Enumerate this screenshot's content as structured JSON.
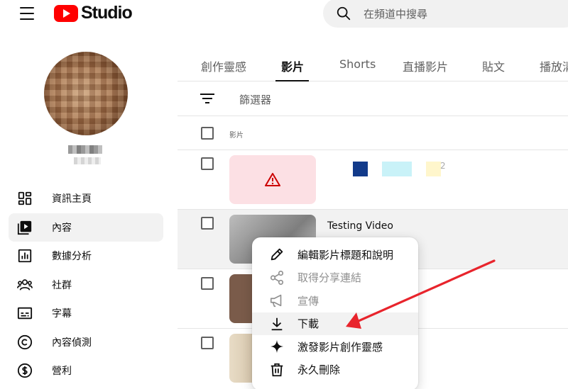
{
  "header": {
    "logo_text": "Studio",
    "search_placeholder": "在頻道中搜尋"
  },
  "sidebar": {
    "items": [
      {
        "label": "資訊主頁",
        "icon": "dashboard-icon",
        "active": false
      },
      {
        "label": "內容",
        "icon": "content-icon",
        "active": true
      },
      {
        "label": "數據分析",
        "icon": "analytics-icon",
        "active": false
      },
      {
        "label": "社群",
        "icon": "community-icon",
        "active": false
      },
      {
        "label": "字幕",
        "icon": "subtitles-icon",
        "active": false
      },
      {
        "label": "內容偵測",
        "icon": "copyright-icon",
        "active": false
      },
      {
        "label": "營利",
        "icon": "monetization-icon",
        "active": false
      }
    ]
  },
  "tabs": [
    {
      "label": "創作靈感",
      "active": false
    },
    {
      "label": "影片",
      "active": true
    },
    {
      "label": "Shorts",
      "active": false
    },
    {
      "label": "直播影片",
      "active": false
    },
    {
      "label": "貼文",
      "active": false
    },
    {
      "label": "播放清",
      "active": false
    }
  ],
  "filter": {
    "label": "篩選器"
  },
  "table": {
    "column_header": "影片",
    "rows": [
      {
        "title": "",
        "number": "2",
        "thumbnail": "error"
      },
      {
        "title": "Testing Video",
        "thumbnail": "video"
      },
      {
        "title": "",
        "thumbnail": "video"
      },
      {
        "title": "",
        "thumbnail": "video"
      }
    ]
  },
  "menu": {
    "items": [
      {
        "label": "編輯影片標題和說明",
        "icon": "pencil-icon",
        "disabled": false
      },
      {
        "label": "取得分享連結",
        "icon": "share-icon",
        "disabled": true
      },
      {
        "label": "宣傳",
        "icon": "megaphone-icon",
        "disabled": true
      },
      {
        "label": "下載",
        "icon": "download-icon",
        "disabled": false,
        "highlighted": true
      },
      {
        "label": "激發影片創作靈感",
        "icon": "sparkle-icon",
        "disabled": false
      },
      {
        "label": "永久刪除",
        "icon": "trash-icon",
        "disabled": false
      }
    ]
  },
  "colors": {
    "brand_red": "#ff0000",
    "annotation_arrow": "#e8242c",
    "error_icon": "#cc0000"
  }
}
